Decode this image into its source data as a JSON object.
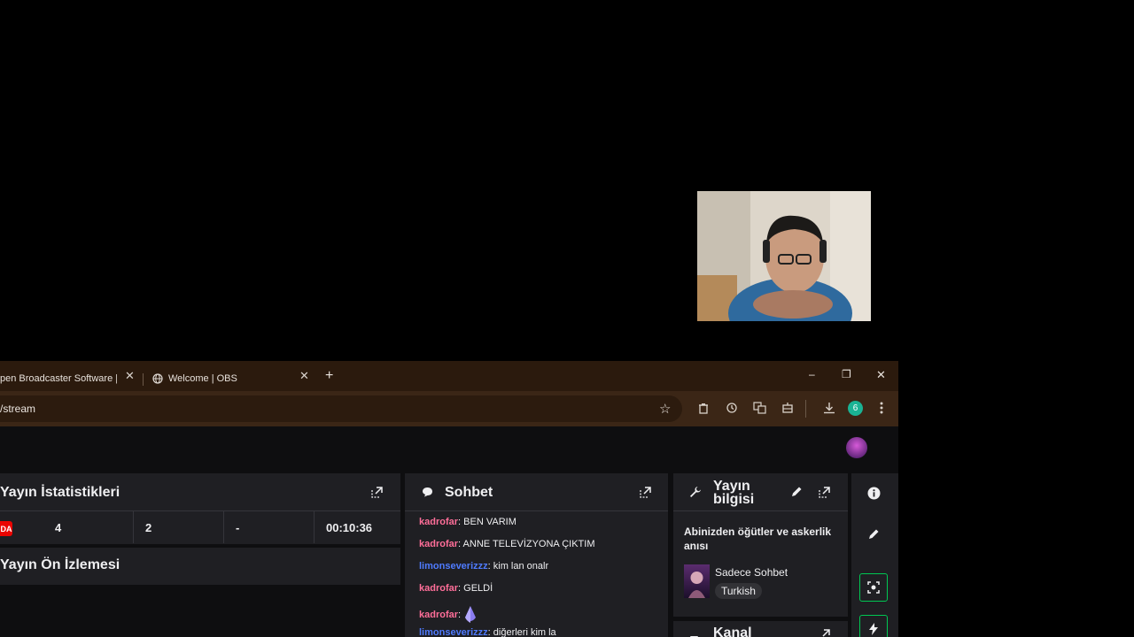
{
  "tabs": [
    {
      "label": "pen Broadcaster Software | O",
      "close": "✕"
    },
    {
      "label": "Welcome | OBS",
      "close": "✕"
    }
  ],
  "new_tab": "+",
  "window_controls": {
    "minimize": "–",
    "restore": "❐",
    "close": "✕"
  },
  "address": {
    "url": "/stream"
  },
  "profile_initial": "6",
  "stats_panel": {
    "title": "Yayın İstatistikleri",
    "live_badge": "DA",
    "values": [
      "4",
      "2",
      "-",
      "00:10:36"
    ]
  },
  "preview_panel": {
    "title": "Yayın Ön İzlemesi"
  },
  "chat_panel": {
    "title": "Sohbet",
    "messages": [
      {
        "user": "kadrofar",
        "text": "BEN VARIM"
      },
      {
        "user": "kadrofar",
        "text": "ANNE TELEVİZYONA ÇIKTIM"
      },
      {
        "user": "limonseverizzz",
        "text": "kim lan onalr"
      },
      {
        "user": "kadrofar",
        "text": "GELDİ"
      },
      {
        "user": "kadrofar",
        "text": ""
      },
      {
        "user": "limonseverizzz",
        "text": "diğerleri kim la"
      }
    ]
  },
  "stream_info": {
    "title": "Yayın bilgisi",
    "stream_title": "Abinizden öğütler ve askerlik anısı",
    "category": "Sadece Sohbet",
    "tag": "Turkish"
  },
  "channel_panel": {
    "title": "Kanal"
  },
  "colors": {
    "chat_user_pink": "#ff6e99",
    "chat_user_blue": "#4f7bff",
    "live_red": "#eb0400",
    "accent_green": "#00c853"
  }
}
